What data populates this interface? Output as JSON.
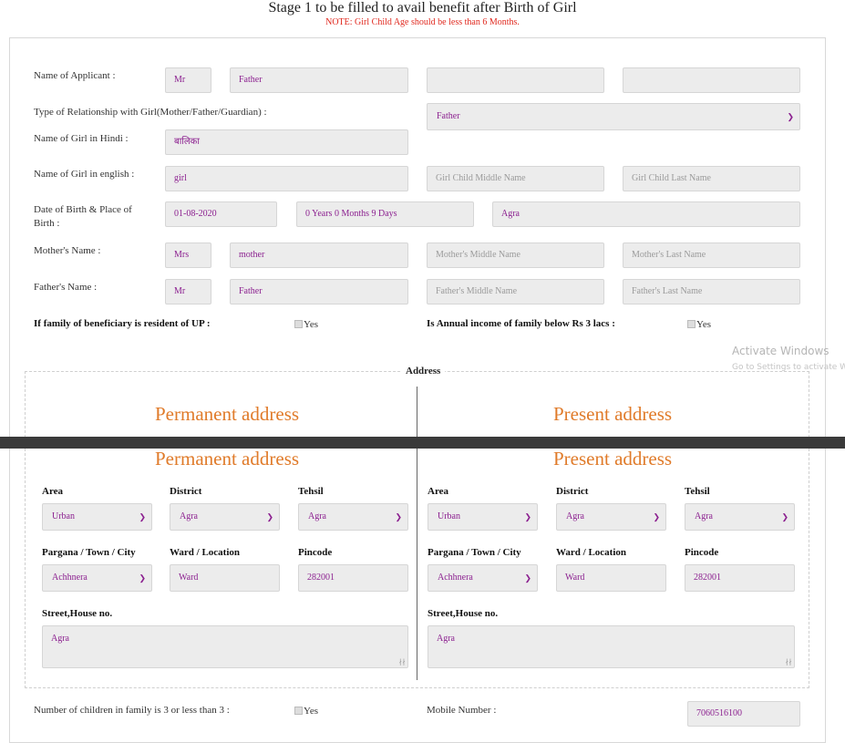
{
  "header": {
    "title": "Stage 1 to be filled to avail benefit after Birth of Girl",
    "note": "NOTE: Girl Child Age should be less than 6 Months."
  },
  "applicant": {
    "label": "Name of Applicant :",
    "title": "Mr",
    "first": "Father",
    "middle": "",
    "last": ""
  },
  "relationship": {
    "label": "Type of Relationship with Girl(Mother/Father/Guardian) :",
    "value": "Father"
  },
  "girl_hindi": {
    "label": "Name of Girl in Hindi :",
    "value": "बालिका"
  },
  "girl_english": {
    "label": "Name of Girl in english :",
    "first": "girl",
    "middle_placeholder": "Girl Child Middle Name",
    "last_placeholder": "Girl Child Last Name"
  },
  "dob": {
    "label_line1": "Date of Birth & Place of",
    "label_line2": "Birth :",
    "date": "01-08-2020",
    "age": "0 Years 0 Months 9 Days",
    "place": "Agra"
  },
  "mother": {
    "label": "Mother's Name :",
    "title": "Mrs",
    "first": "mother",
    "middle_placeholder": "Mother's Middle Name",
    "last_placeholder": "Mother's Last Name"
  },
  "father": {
    "label": "Father's Name :",
    "title": "Mr",
    "first": "Father",
    "middle_placeholder": "Father's Middle Name",
    "last_placeholder": "Father's Last Name"
  },
  "resident_up": {
    "label": "If family of beneficiary is resident of UP :",
    "checkbox_label": "Yes"
  },
  "income": {
    "label": "Is Annual income of family below Rs 3 lacs :",
    "checkbox_label": "Yes"
  },
  "address": {
    "legend": "Address",
    "permanent": {
      "heading": "Permanent address",
      "area_label": "Area",
      "area": "Urban",
      "district_label": "District",
      "district": "Agra",
      "tehsil_label": "Tehsil",
      "tehsil": "Agra",
      "pargana_label": "Pargana / Town / City",
      "pargana": "Achhnera",
      "ward_label": "Ward / Location",
      "ward": "Ward",
      "pincode_label": "Pincode",
      "pincode": "282001",
      "street_label": "Street,House no.",
      "street": "Agra"
    },
    "present": {
      "heading": "Present address",
      "area_label": "Area",
      "area": "Urban",
      "district_label": "District",
      "district": "Agra",
      "tehsil_label": "Tehsil",
      "tehsil": "Agra",
      "pargana_label": "Pargana / Town / City",
      "pargana": "Achhnera",
      "ward_label": "Ward / Location",
      "ward": "Ward",
      "pincode_label": "Pincode",
      "pincode": "282001",
      "street_label": "Street,House no.",
      "street": "Agra"
    }
  },
  "children": {
    "label": "Number of children in family is 3 or less than 3 :",
    "checkbox_label": "Yes"
  },
  "mobile": {
    "label": "Mobile Number :",
    "value": "7060516100"
  },
  "watermark": {
    "line1": "Activate Windows",
    "line2": "Go to Settings to activate W"
  },
  "icons": {
    "dropdown": "chevron-down-icon",
    "resize": "resize-grip-icon"
  },
  "colors": {
    "input_text": "#8b1f8f",
    "note": "#e0281e",
    "address_heading": "#e07b2a",
    "input_bg": "#ececec"
  }
}
